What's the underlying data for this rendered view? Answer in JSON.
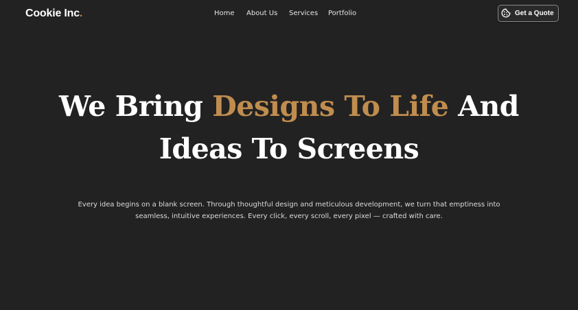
{
  "brand": {
    "name": "Cookie Inc",
    "dot": ".",
    "accent_color": "#c08d4f",
    "background_color": "#222222"
  },
  "nav": {
    "items": [
      {
        "label": "Home"
      },
      {
        "label": "About Us"
      },
      {
        "label": "Services"
      },
      {
        "label": "Portfolio"
      }
    ]
  },
  "cta": {
    "label": "Get a Quote",
    "icon": "cookie-icon"
  },
  "hero": {
    "title_part1": "We Bring ",
    "title_accent": "Designs To Life",
    "title_part2": " And",
    "title_line2": "Ideas To Screens",
    "description": "Every idea begins on a blank screen. Through thoughtful design and meticulous development, we turn that emptiness into seamless, intuitive experiences. Every click, every scroll, every pixel — crafted with care."
  }
}
